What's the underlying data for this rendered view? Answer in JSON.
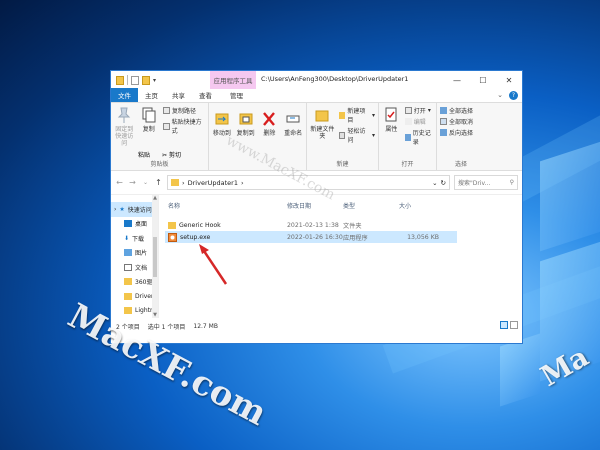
{
  "window": {
    "contextual_tab": "应用程序工具",
    "path_title": "C:\\Users\\AnFeng300\\Desktop\\DriverUpdater1",
    "controls": [
      "—",
      "☐",
      "✕"
    ]
  },
  "tabs": [
    {
      "label": "文件",
      "active": true
    },
    {
      "label": "主页"
    },
    {
      "label": "共享"
    },
    {
      "label": "查看"
    },
    {
      "label": "管理"
    }
  ],
  "ribbon": {
    "clipboard": {
      "pin_label": "固定到快速访问",
      "copy_label": "复制",
      "paste_label": "粘贴",
      "cut": "剪切",
      "copy_path": "复制路径",
      "paste_shortcut": "粘贴快捷方式",
      "group_label": "剪贴板"
    },
    "organize": {
      "move_to": "移动到",
      "copy_to": "复制到",
      "delete": "删除",
      "rename": "重命名"
    },
    "new": {
      "new_folder": "新建文件夹",
      "new_item": "新建项目",
      "easy_access": "轻松访问",
      "group_label": "新建"
    },
    "open": {
      "properties": "属性",
      "open": "打开",
      "edit": "编辑",
      "history": "历史记录",
      "group_label": "打开"
    },
    "select": {
      "select_all": "全部选择",
      "select_none": "全部取消",
      "invert": "反向选择",
      "group_label": "选择"
    }
  },
  "address": {
    "crumb": "DriverUpdater1",
    "search_placeholder": "搜索\"Driv..."
  },
  "navpane": [
    {
      "label": "快速访问",
      "icon": "star-icon",
      "selected": true
    },
    {
      "label": "桌面",
      "icon": "desktop-icon"
    },
    {
      "label": "下载",
      "icon": "download-icon"
    },
    {
      "label": "图片",
      "icon": "pictures-icon"
    },
    {
      "label": "文档",
      "icon": "documents-icon"
    },
    {
      "label": "360驱",
      "icon": "folder-icon"
    },
    {
      "label": "Driver",
      "icon": "folder-icon"
    },
    {
      "label": "Lightr",
      "icon": "folder-icon"
    }
  ],
  "columns": {
    "name": "名称",
    "date": "修改日期",
    "type": "类型",
    "size": "大小"
  },
  "files": [
    {
      "name": "Generic Hook",
      "date": "2021-02-13 1:38",
      "type": "文件夹",
      "size": "",
      "icon": "folder-icon"
    },
    {
      "name": "setup.exe",
      "date": "2022-01-26 16:30",
      "type": "应用程序",
      "size": "13,056 KB",
      "icon": "exe-icon",
      "selected": true
    }
  ],
  "status": {
    "count": "2 个项目",
    "selected": "选中 1 个项目",
    "size": "12.7 MB"
  },
  "watermark": {
    "main": "MacXF.com",
    "faint": "www.MacXF.com",
    "right": "Ma"
  },
  "colors": {
    "accent": "#1979ca",
    "selection": "#cce8ff",
    "folder": "#f3c54a",
    "arrow": "#d62828"
  }
}
